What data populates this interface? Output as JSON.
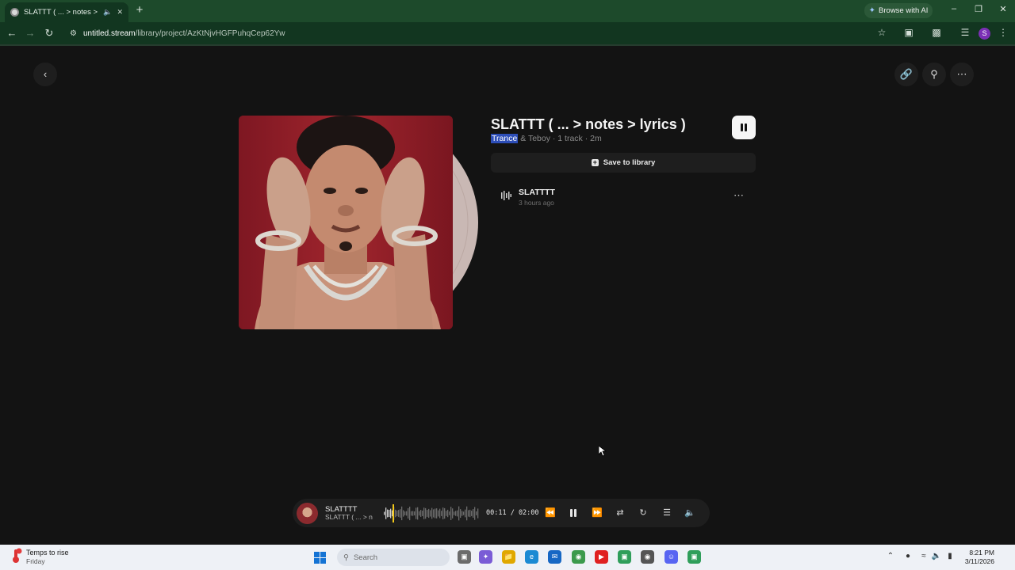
{
  "browser": {
    "tab_title": "SLATTT ( ... > notes > lyrics",
    "new_tab_label": "+",
    "ai_button_label": "Browse with AI",
    "url_host": "untitled.stream",
    "url_path": "/library/project/AzKtNjvHGFPuhqCep62Yw",
    "profile_initial": "S"
  },
  "project": {
    "title": "SLATTT ( ... > notes > lyrics )",
    "genre": "Trance",
    "meta_rest": " & Teboy · 1 track · 2m",
    "save_label": "Save to library",
    "tracks": [
      {
        "name": "SLATTTT",
        "time": "3 hours ago"
      }
    ]
  },
  "player": {
    "track_title": "SLATTTT",
    "track_subtitle": "SLATTT ( ... > notes > lyrics )",
    "time_display": "00:11 / 02:00",
    "progress": 0.092
  },
  "taskbar": {
    "weather_title": "Temps to rise",
    "weather_sub": "Friday",
    "weather_badge": "2",
    "search_placeholder": "Search",
    "clock_time": "8:21 PM",
    "clock_date": "3/11/2026"
  },
  "colors": {
    "browser_frame": "#1d4a2b",
    "toolbar": "#123620",
    "page_bg": "#131313",
    "surface": "#1e1e1e",
    "selection": "#2d4eb8",
    "playhead": "#f2c81a"
  }
}
